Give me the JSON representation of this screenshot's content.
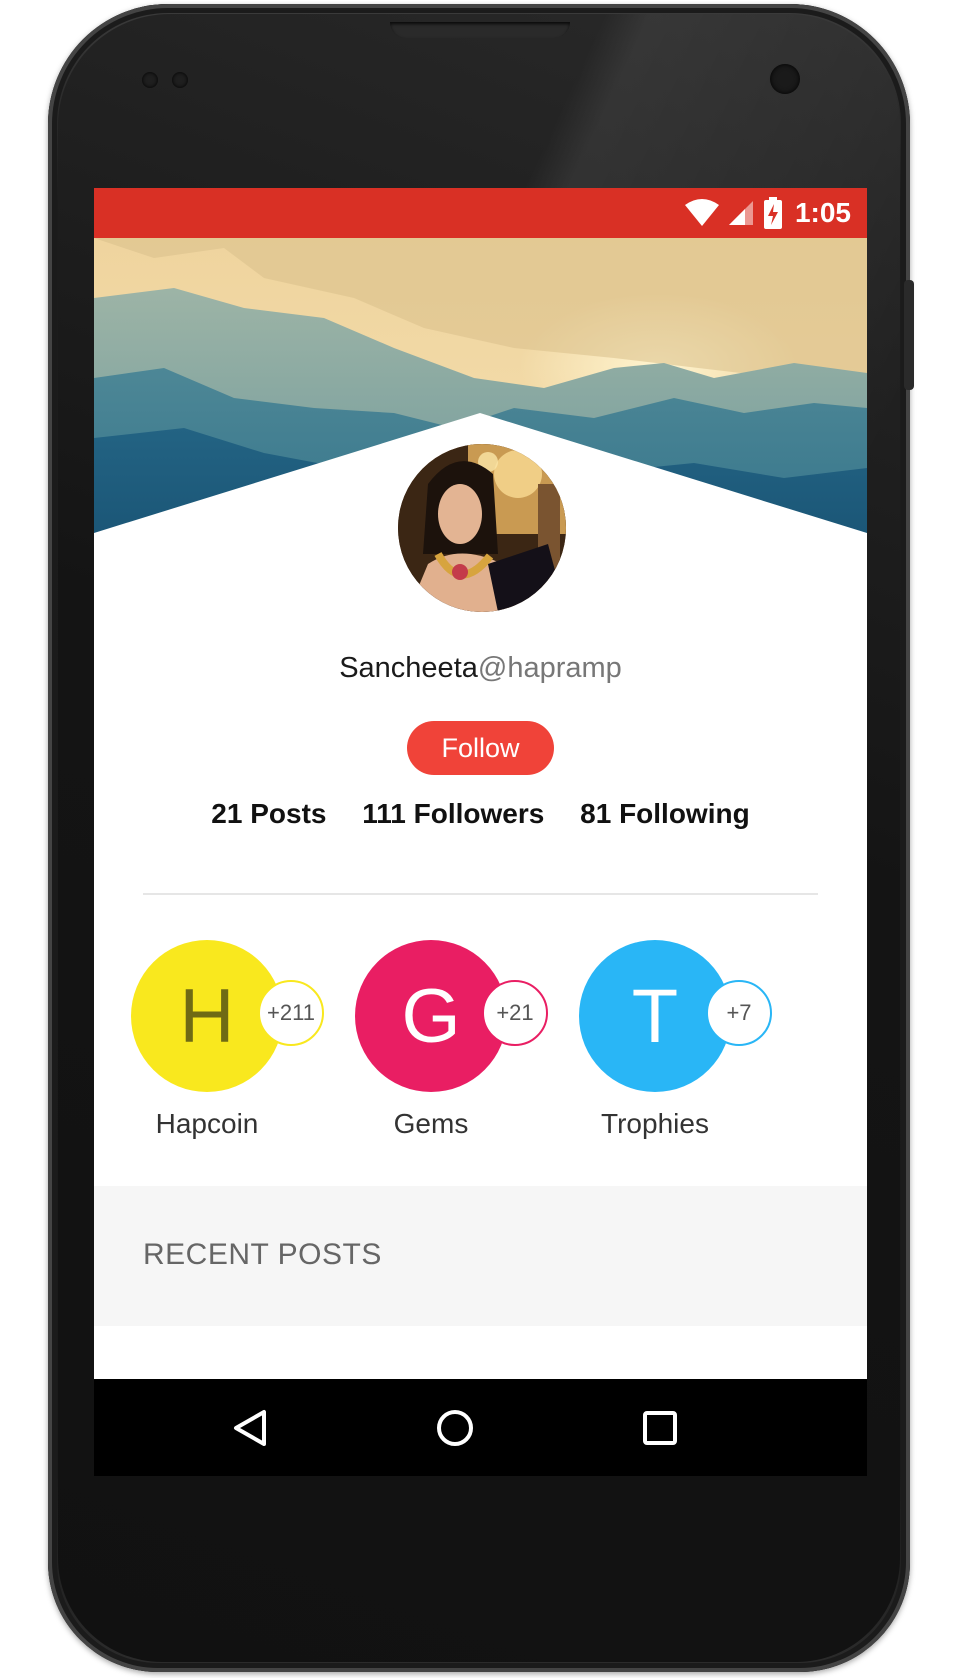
{
  "status_bar": {
    "time": "1:05",
    "color": "#d93025"
  },
  "profile": {
    "name": "Sancheeta",
    "handle": "@hapramp",
    "follow_label": "Follow"
  },
  "stats": {
    "posts": "21 Posts",
    "followers": "111 Followers",
    "following": "81 Following"
  },
  "badges": [
    {
      "letter": "H",
      "count": "+211",
      "label": "Hapcoin",
      "color": "#f9e81e",
      "letter_color": "#6f6a14"
    },
    {
      "letter": "G",
      "count": "+21",
      "label": "Gems",
      "color": "#e91e63",
      "letter_color": "#ffffff"
    },
    {
      "letter": "T",
      "count": "+7",
      "label": "Trophies",
      "color": "#29b6f6",
      "letter_color": "#ffffff"
    }
  ],
  "recent_posts": {
    "title": "RECENT POSTS"
  },
  "nav": {
    "icons": [
      "back-icon",
      "home-icon",
      "recents-icon"
    ]
  }
}
